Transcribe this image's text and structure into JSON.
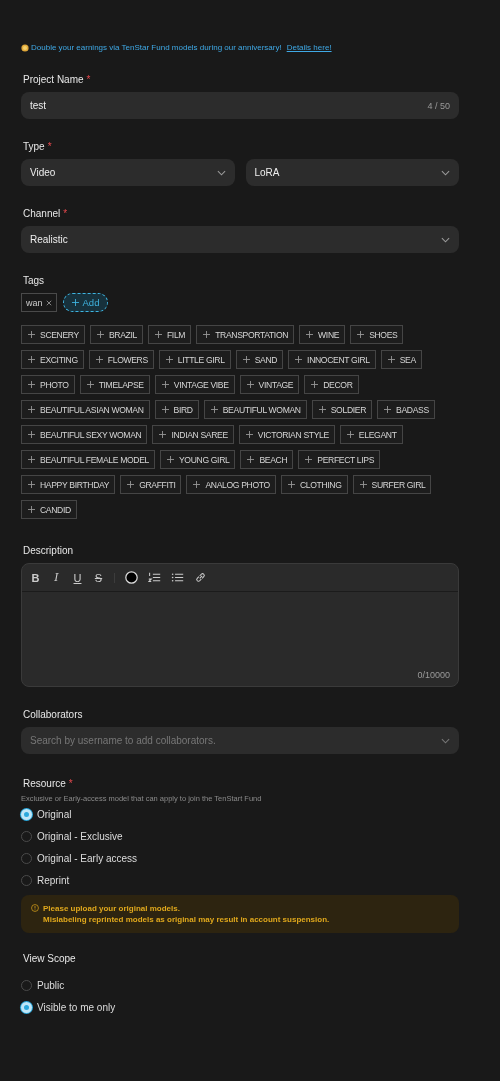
{
  "banner": {
    "text": "Double your earnings via TenStar Fund models during our anniversary!",
    "link": "Details here!"
  },
  "project_name": {
    "label": "Project Name",
    "required_mark": "*",
    "value": "test",
    "counter": "4 / 50"
  },
  "type": {
    "label": "Type",
    "required_mark": "*",
    "selects": [
      {
        "value": "Video"
      },
      {
        "value": "LoRA"
      }
    ]
  },
  "channel": {
    "label": "Channel",
    "required_mark": "*",
    "value": "Realistic"
  },
  "tags": {
    "label": "Tags",
    "chosen": [
      {
        "label": "wan"
      }
    ],
    "add_button": "Add",
    "suggestions": [
      "SCENERY",
      "BRAZIL",
      "FILM",
      "TRANSPORTATION",
      "WINE",
      "SHOES",
      "EXCITING",
      "FLOWERS",
      "LITTLE GIRL",
      "SAND",
      "INNOCENT GIRL",
      "SEA",
      "PHOTO",
      "TIMELAPSE",
      "VINTAGE VIBE",
      "VINTAGE",
      "DECOR",
      "BEAUTIFUL ASIAN WOMAN",
      "BIRD",
      "BEAUTIFUL WOMAN",
      "SOLDIER",
      "BADASS",
      "BEAUTIFUL SEXY WOMAN",
      "INDIAN SAREE",
      "VICTORIAN STYLE",
      "ELEGANT",
      "BEAUTIFUL FEMALE MODEL",
      "YOUNG GIRL",
      "BEACH",
      "PERFECT LIPS",
      "HAPPY BIRTHDAY",
      "GRAFFITI",
      "ANALOG PHOTO",
      "CLOTHING",
      "SURFER GIRL",
      "CANDID"
    ]
  },
  "description": {
    "label": "Description",
    "toolbar": [
      {
        "kind": "bold",
        "label": "B"
      },
      {
        "kind": "italic",
        "label": "I"
      },
      {
        "kind": "underline",
        "label": "U"
      },
      {
        "kind": "strike",
        "label": "S"
      },
      {
        "kind": "divider"
      },
      {
        "kind": "color",
        "color": "#000000"
      },
      {
        "kind": "ordered"
      },
      {
        "kind": "bullet"
      },
      {
        "kind": "link"
      }
    ],
    "counter": "0/10000"
  },
  "collaborators": {
    "label": "Collaborators",
    "placeholder": "Search by username to add collaborators."
  },
  "resource": {
    "label": "Resource",
    "required_mark": "*",
    "hint": "Exclusive or Early-access model that can apply to join the TenStart Fund",
    "options": [
      {
        "label": "Original",
        "selected": true
      },
      {
        "label": "Original - Exclusive",
        "selected": false
      },
      {
        "label": "Original - Early access",
        "selected": false
      },
      {
        "label": "Reprint",
        "selected": false
      }
    ],
    "warning": [
      "Please upload your original models.",
      "Mislabeling reprinted models as original may result in account suspension."
    ]
  },
  "view_scope": {
    "label": "View Scope",
    "options": [
      {
        "label": "Public",
        "selected": false
      },
      {
        "label": "Visible to me only",
        "selected": true
      }
    ]
  }
}
